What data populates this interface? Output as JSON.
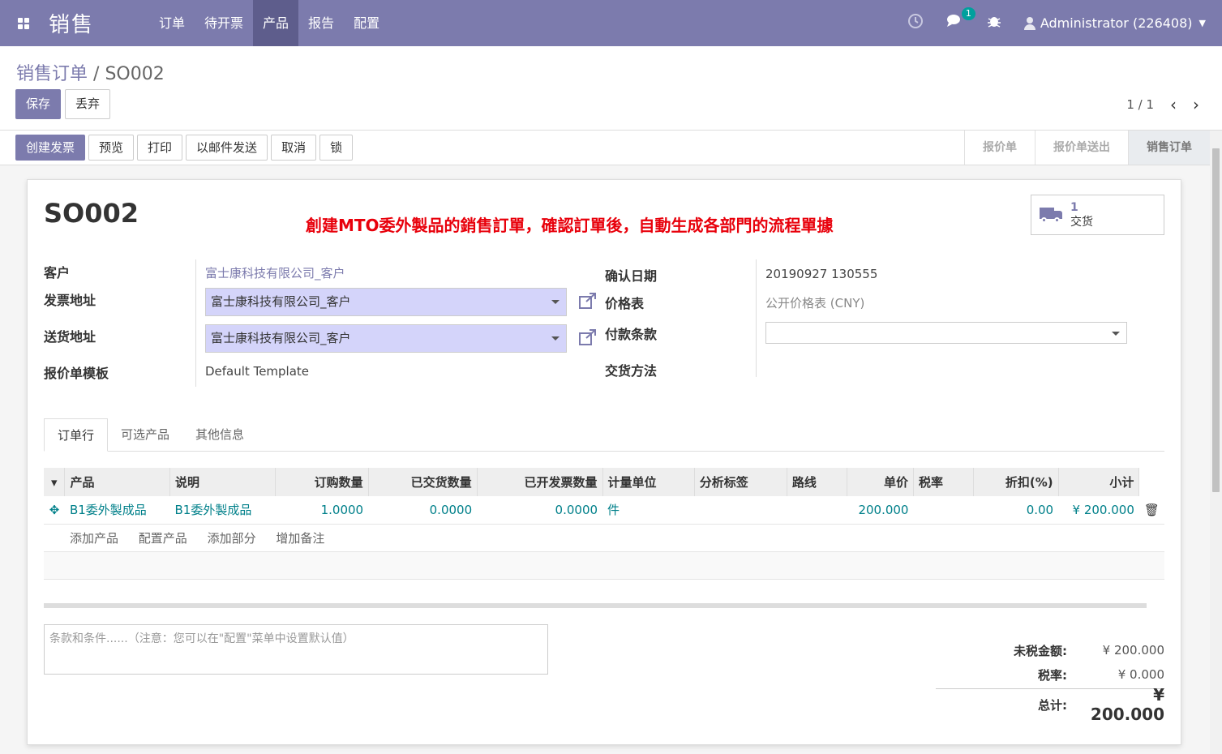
{
  "app": {
    "title": "销售"
  },
  "menu": [
    "订单",
    "待开票",
    "产品",
    "报告",
    "配置"
  ],
  "topbar": {
    "chat_badge": "1",
    "user": "Administrator (226408)"
  },
  "breadcrumb": {
    "parent": "销售订单",
    "sep": "/",
    "current": "SO002"
  },
  "buttons": {
    "save": "保存",
    "discard": "丢弃"
  },
  "pager": {
    "text": "1 / 1"
  },
  "actions": [
    "创建发票",
    "预览",
    "打印",
    "以邮件发送",
    "取消",
    "锁"
  ],
  "stages": [
    "报价单",
    "报价单送出",
    "销售订单"
  ],
  "form": {
    "name": "SO002",
    "annotation": "創建MTO委外製品的銷售訂單，確認訂單後，自動生成各部門的流程單據",
    "delivery_count": "1",
    "delivery_label": "交货",
    "customer_label": "客户",
    "customer": "富士康科技有限公司_客户",
    "invoice_addr_label": "发票地址",
    "invoice_addr": "富士康科技有限公司_客户",
    "shipping_addr_label": "送货地址",
    "shipping_addr": "富士康科技有限公司_客户",
    "template_label": "报价单模板",
    "template": "Default Template",
    "confirm_date_label": "确认日期",
    "confirm_date": "20190927 130555",
    "pricelist_label": "价格表",
    "pricelist": "公开价格表 (CNY)",
    "payment_terms_label": "付款条款",
    "payment_terms": "",
    "delivery_method_label": "交货方法"
  },
  "tabs": [
    "订单行",
    "可选产品",
    "其他信息"
  ],
  "table": {
    "headers": [
      "产品",
      "说明",
      "订购数量",
      "已交货数量",
      "已开发票数量",
      "计量单位",
      "分析标签",
      "路线",
      "单价",
      "税率",
      "折扣(%)",
      "小计"
    ],
    "rows": [
      {
        "product": "B1委外製成品",
        "desc": "B1委外製成品",
        "qty": "1.0000",
        "delivered": "0.0000",
        "invoiced": "0.0000",
        "uom": "件",
        "analytic": "",
        "route": "",
        "price": "200.000",
        "tax": "",
        "discount": "0.00",
        "subtotal": "¥ 200.000"
      }
    ],
    "add_links": [
      "添加产品",
      "配置产品",
      "添加部分",
      "增加备注"
    ]
  },
  "notes": {
    "placeholder": "条款和条件......（注意：您可以在\"配置\"菜单中设置默认值）"
  },
  "totals": {
    "untaxed_label": "未税金额:",
    "untaxed": "¥ 200.000",
    "tax_label": "税率:",
    "tax": "¥ 0.000",
    "total_label": "总计:",
    "total": "¥ 200.000"
  }
}
